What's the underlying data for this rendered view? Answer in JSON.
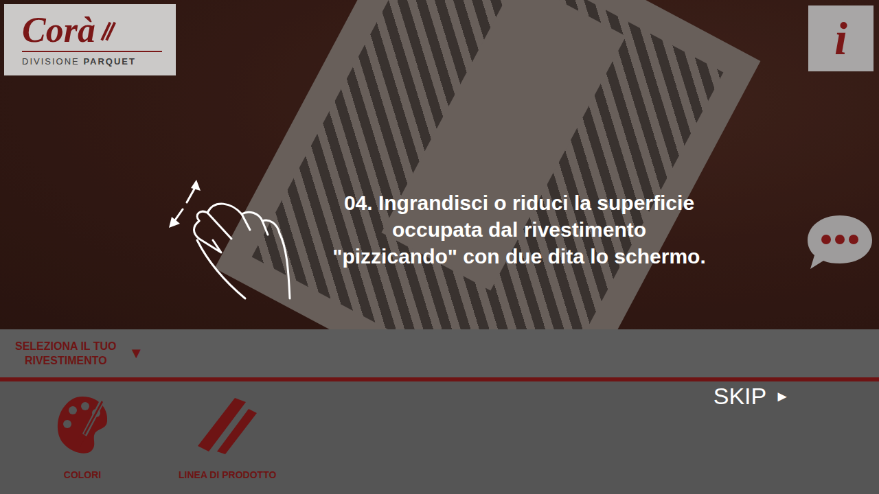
{
  "logo": {
    "brand": "Corà",
    "division_light": "DIVISIONE",
    "division_bold": "PARQUET"
  },
  "info_button": {
    "label": "i"
  },
  "tutorial": {
    "lines": [
      "04. Ingrandisci o riduci la superficie",
      "occupata dal rivestimento",
      "\"pizzicando\" con due dita lo schermo."
    ]
  },
  "selector": {
    "lines": [
      "SELEZIONA IL TUO",
      "RIVESTIMENTO"
    ],
    "arrow": "▼"
  },
  "tools": [
    {
      "label": "COLORI",
      "kind": "palette"
    },
    {
      "label": "LINEA DI PRODOTTO",
      "kind": "line"
    }
  ],
  "skip": {
    "label": "SKIP",
    "arrow": "►"
  }
}
